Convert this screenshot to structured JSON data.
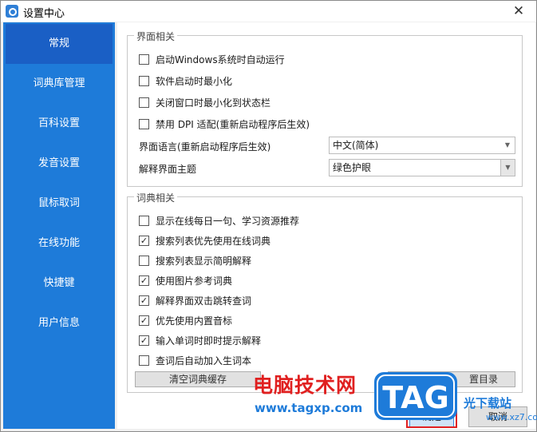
{
  "window": {
    "title": "设置中心",
    "close_symbol": "✕"
  },
  "sidebar": {
    "items": [
      {
        "label": "常规",
        "active": true
      },
      {
        "label": "词典库管理",
        "active": false
      },
      {
        "label": "百科设置",
        "active": false
      },
      {
        "label": "发音设置",
        "active": false
      },
      {
        "label": "鼠标取词",
        "active": false
      },
      {
        "label": "在线功能",
        "active": false
      },
      {
        "label": "快捷键",
        "active": false
      },
      {
        "label": "用户信息",
        "active": false
      }
    ]
  },
  "interface": {
    "legend": "界面相关",
    "options": [
      {
        "label": "启动Windows系统时自动运行",
        "checked": false
      },
      {
        "label": "软件启动时最小化",
        "checked": false
      },
      {
        "label": "关闭窗口时最小化到状态栏",
        "checked": false
      },
      {
        "label": "禁用 DPI 适配(重新启动程序后生效)",
        "checked": false
      }
    ],
    "language_label": "界面语言(重新启动程序后生效)",
    "language_value": "中文(简体)",
    "theme_label": "解释界面主题",
    "theme_value": "绿色护眼"
  },
  "dictionary": {
    "legend": "词典相关",
    "options": [
      {
        "label": "显示在线每日一句、学习资源推荐",
        "checked": false
      },
      {
        "label": "搜索列表优先使用在线词典",
        "checked": true
      },
      {
        "label": "搜索列表显示简明解释",
        "checked": false
      },
      {
        "label": "使用图片参考词典",
        "checked": true
      },
      {
        "label": "解释界面双击跳转查词",
        "checked": true
      },
      {
        "label": "优先使用内置音标",
        "checked": true
      },
      {
        "label": "输入单词时即时提示解释",
        "checked": true
      },
      {
        "label": "查词后自动加入生词本",
        "checked": false
      }
    ],
    "clear_cache_label": "清空词典缓存",
    "reset_dir_label": "置目录"
  },
  "footer": {
    "ok_label": "确定",
    "cancel_label": "取消"
  },
  "watermark": {
    "brand_text": "电脑技术网",
    "url_text": "www.tagxp.com",
    "logo_text": "TAG",
    "site_text": "光下载站",
    "site_url": "www.xz7.com"
  },
  "icons": {
    "check": "✓",
    "dropdown": "▼"
  }
}
